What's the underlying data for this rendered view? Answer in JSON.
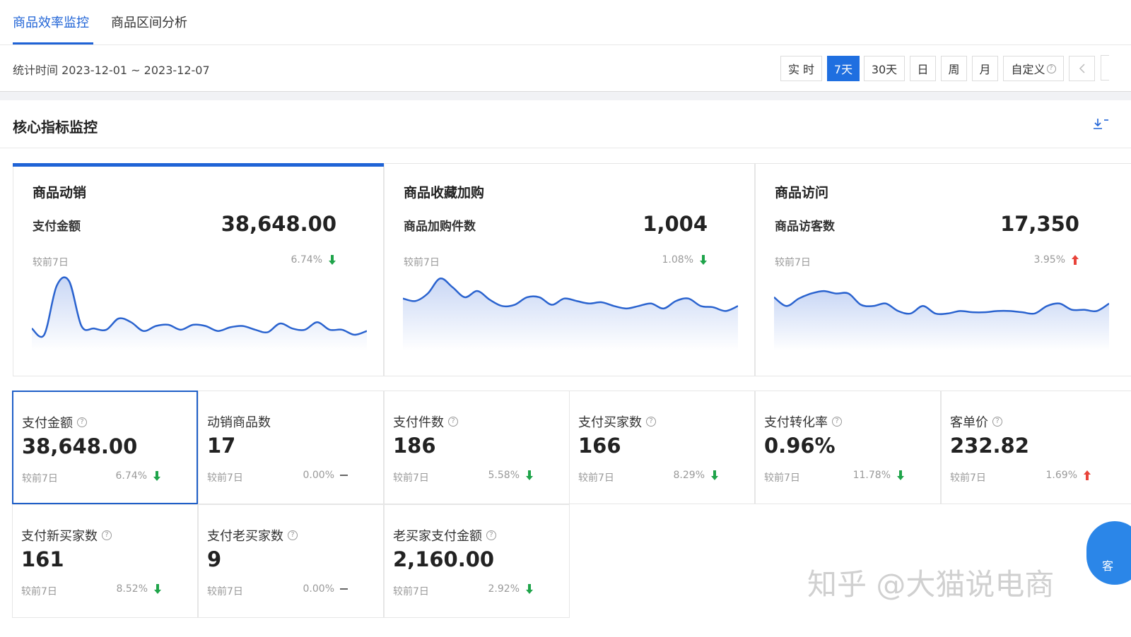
{
  "tabs": [
    {
      "label": "商品效率监控",
      "active": true
    },
    {
      "label": "商品区间分析",
      "active": false
    }
  ],
  "timebar": {
    "stat_time": "统计时间 2023-12-01 ~ 2023-12-07",
    "periods": [
      {
        "label": "实 时",
        "active": false
      },
      {
        "label": "7天",
        "active": true
      },
      {
        "label": "30天",
        "active": false
      },
      {
        "label": "日",
        "active": false
      },
      {
        "label": "周",
        "active": false
      },
      {
        "label": "月",
        "active": false
      },
      {
        "label": "自定义",
        "active": false
      }
    ],
    "prev_icon": "chevron-left-icon"
  },
  "section": {
    "title": "核心指标监控",
    "download_icon": "download-icon"
  },
  "big_cards": [
    {
      "title": "商品动销",
      "metric": "支付金额",
      "value": "38,648.00",
      "compare": "较前7日",
      "pct": "6.74%",
      "trend": "down",
      "active": true,
      "series": [
        38,
        33,
        72,
        76,
        40,
        38,
        37,
        46,
        43,
        36,
        40,
        41,
        37,
        41,
        40,
        36,
        39,
        40,
        37,
        35,
        42,
        38,
        37,
        43,
        37,
        37,
        33,
        36
      ]
    },
    {
      "title": "商品收藏加购",
      "metric": "商品加购件数",
      "value": "1,004",
      "compare": "较前7日",
      "pct": "1.08%",
      "trend": "down",
      "active": false,
      "series": [
        62,
        60,
        66,
        78,
        71,
        63,
        68,
        61,
        56,
        57,
        63,
        63,
        57,
        62,
        60,
        58,
        59,
        56,
        54,
        56,
        58,
        54,
        60,
        62,
        56,
        55,
        52,
        56
      ]
    },
    {
      "title": "商品访问",
      "metric": "商品访客数",
      "value": "17,350",
      "compare": "较前7日",
      "pct": "3.95%",
      "trend": "up",
      "active": false,
      "series": [
        63,
        56,
        62,
        66,
        68,
        66,
        66,
        57,
        56,
        58,
        52,
        50,
        56,
        50,
        50,
        52,
        51,
        51,
        52,
        52,
        51,
        50,
        56,
        58,
        53,
        53,
        52,
        58
      ]
    }
  ],
  "small_cards": [
    {
      "label": "支付金额",
      "help": true,
      "value": "38,648.00",
      "compare": "较前7日",
      "pct": "6.74%",
      "trend": "down",
      "selected": true
    },
    {
      "label": "动销商品数",
      "help": false,
      "value": "17",
      "compare": "较前7日",
      "pct": "0.00%",
      "trend": "flat",
      "selected": false
    },
    {
      "label": "支付件数",
      "help": true,
      "value": "186",
      "compare": "较前7日",
      "pct": "5.58%",
      "trend": "down",
      "selected": false
    },
    {
      "label": "支付买家数",
      "help": true,
      "value": "166",
      "compare": "较前7日",
      "pct": "8.29%",
      "trend": "down",
      "selected": false
    },
    {
      "label": "支付转化率",
      "help": true,
      "value": "0.96%",
      "compare": "较前7日",
      "pct": "11.78%",
      "trend": "down",
      "selected": false
    },
    {
      "label": "客单价",
      "help": true,
      "value": "232.82",
      "compare": "较前7日",
      "pct": "1.69%",
      "trend": "up",
      "selected": false
    },
    {
      "label": "支付新买家数",
      "help": true,
      "value": "161",
      "compare": "较前7日",
      "pct": "8.52%",
      "trend": "down",
      "selected": false
    },
    {
      "label": "支付老买家数",
      "help": true,
      "value": "9",
      "compare": "较前7日",
      "pct": "0.00%",
      "trend": "flat",
      "selected": false
    },
    {
      "label": "老买家支付金额",
      "help": true,
      "value": "2,160.00",
      "compare": "较前7日",
      "pct": "2.92%",
      "trend": "down",
      "selected": false
    }
  ],
  "watermark": "知乎 @大猫说电商",
  "float_button": {
    "label": "客"
  },
  "colors": {
    "primary": "#1f63d6",
    "down": "#1fa44a",
    "up": "#e8433a",
    "line": "#2a63cf"
  }
}
